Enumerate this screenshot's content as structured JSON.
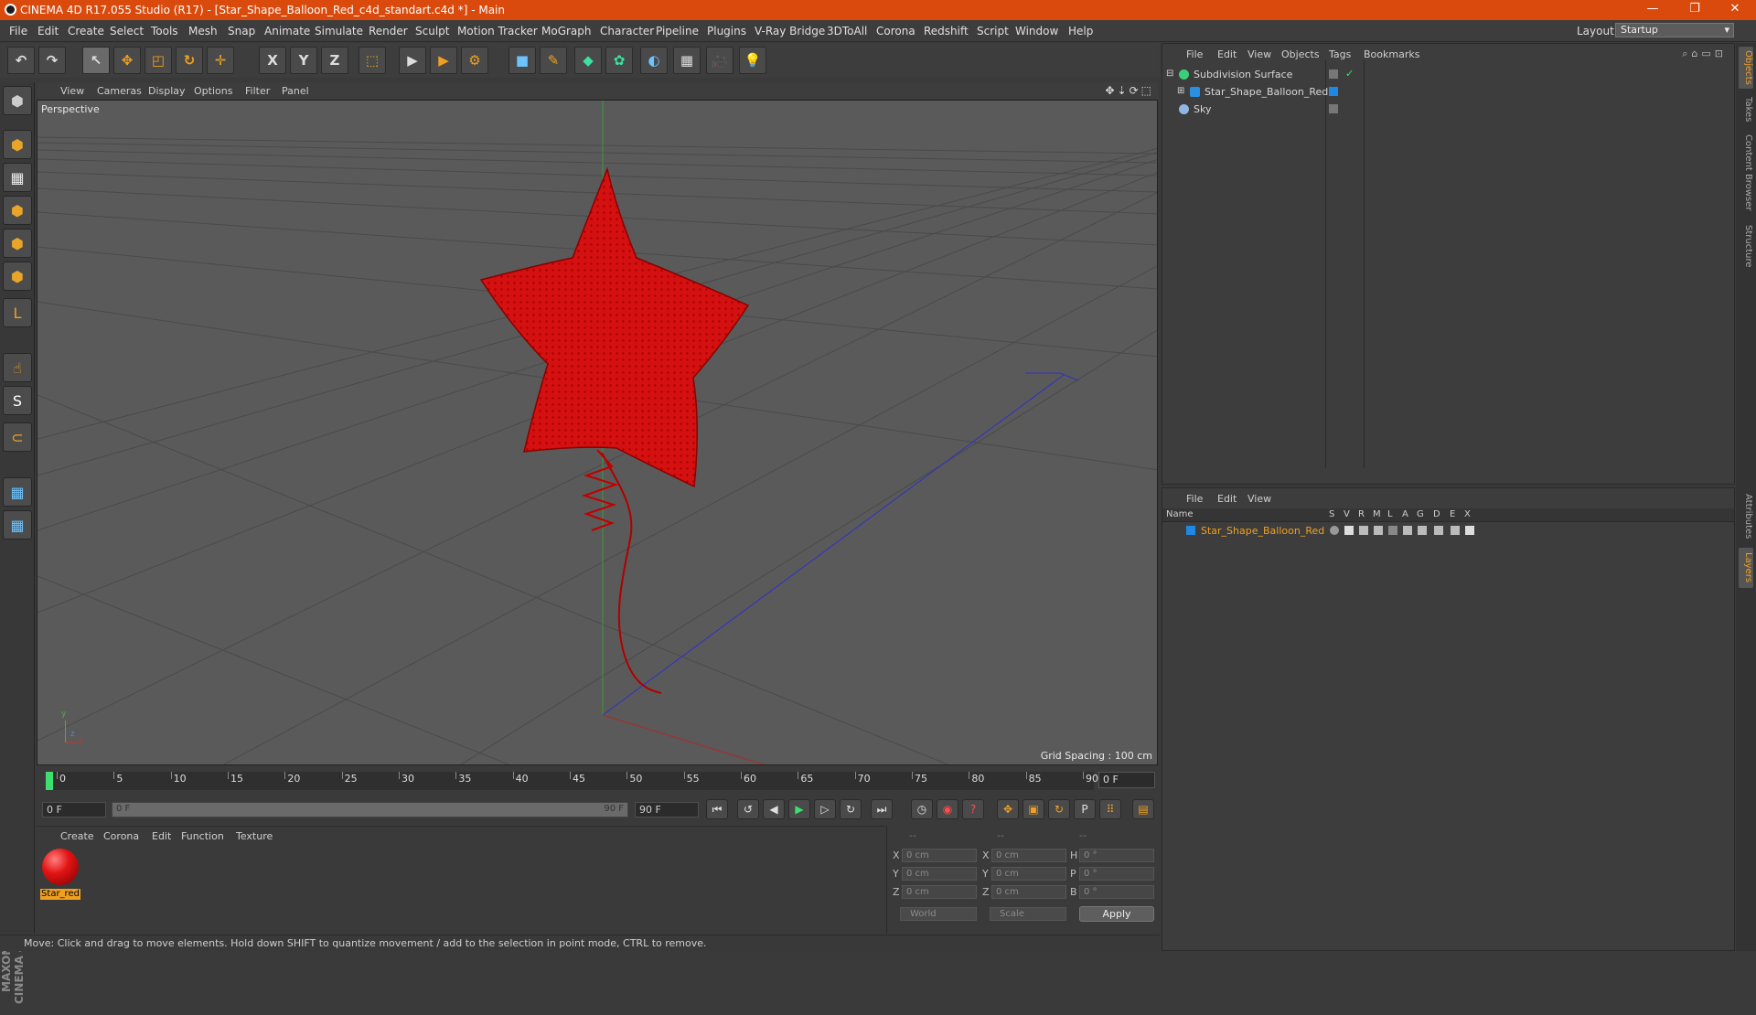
{
  "window": {
    "title": "CINEMA 4D R17.055 Studio (R17) - [Star_Shape_Balloon_Red_c4d_standart.c4d *] - Main",
    "minimize": "—",
    "restore": "❐",
    "close": "✕"
  },
  "menu": [
    "File",
    "Edit",
    "Create",
    "Select",
    "Tools",
    "Mesh",
    "Snap",
    "Animate",
    "Simulate",
    "Render",
    "Sculpt",
    "Motion Tracker",
    "MoGraph",
    "Character",
    "Pipeline",
    "Plugins",
    "V-Ray Bridge",
    "3DToAll",
    "Corona",
    "Redshift",
    "Script",
    "Window",
    "Help"
  ],
  "layout": {
    "label": "Layout:",
    "value": "Startup"
  },
  "toolbar": {
    "undo": "↶",
    "redo": "↷",
    "select": "↖",
    "move": "✥",
    "scale": "◰",
    "rotate": "↻",
    "move2": "✛",
    "x": "X",
    "y": "Y",
    "z": "Z",
    "coord": "⬚",
    "render_view": "▶",
    "render_pv": "▶",
    "render_settings": "⚙",
    "cube": "■",
    "pen": "✎",
    "subdiv": "◆",
    "array": "✿",
    "deform": "◐",
    "floor": "▦",
    "camera": "🎥",
    "light": "💡"
  },
  "left_tools": [
    "⬢",
    "⬢",
    "▦",
    "⬢",
    "⬢",
    "⬢",
    "L",
    "☝",
    "S",
    "⊂",
    "▦",
    "▦"
  ],
  "viewport": {
    "menu": [
      "View",
      "Cameras",
      "Display",
      "Options",
      "Filter",
      "Panel"
    ],
    "nav_icons": "✥⇣⟳⬚",
    "camera_label": "Perspective",
    "grid_spacing": "Grid Spacing : 100 cm",
    "axis": {
      "x": "x",
      "y": "y",
      "z": "z"
    }
  },
  "timeline": {
    "ticks": [
      0,
      5,
      10,
      15,
      20,
      25,
      30,
      35,
      40,
      45,
      50,
      55,
      60,
      65,
      70,
      75,
      80,
      85,
      90
    ],
    "current_frame": "0 F"
  },
  "transport": {
    "start": "0 F",
    "range_start": "0 F",
    "range_end": "90 F",
    "end": "90 F",
    "buttons": [
      "⏮",
      "↺",
      "◀",
      "▶",
      "▷",
      "↻",
      "⏭"
    ],
    "key_buttons": [
      "◷",
      "◉",
      "?",
      "✥",
      "▣",
      "↻",
      "P",
      "⠿",
      "▤"
    ]
  },
  "material_manager": {
    "menu": [
      "Create",
      "Corona",
      "Edit",
      "Function",
      "Texture"
    ],
    "material_name": "Star_red"
  },
  "coordinates": {
    "headers": [
      "--",
      "--",
      "--"
    ],
    "rows": [
      {
        "a": "X",
        "av": "0 cm",
        "b": "X",
        "bv": "0 cm",
        "c": "H",
        "cv": "0 °"
      },
      {
        "a": "Y",
        "av": "0 cm",
        "b": "Y",
        "bv": "0 cm",
        "c": "P",
        "cv": "0 °"
      },
      {
        "a": "Z",
        "av": "0 cm",
        "b": "Z",
        "bv": "0 cm",
        "c": "B",
        "cv": "0 °"
      }
    ],
    "mode": "World",
    "size_mode": "Scale",
    "apply": "Apply"
  },
  "status": "Move: Click and drag to move elements. Hold down SHIFT to quantize movement / add to the selection in point mode, CTRL to remove.",
  "object_manager": {
    "menu": [
      "File",
      "Edit",
      "View",
      "Objects",
      "Tags",
      "Bookmarks"
    ],
    "objects": [
      {
        "name": "Subdivision Surface",
        "color": "#3ad07a"
      },
      {
        "name": "Star_Shape_Balloon_Red",
        "color": "#2a8fe0"
      },
      {
        "name": "Sky",
        "color": "#8fb7e0"
      }
    ]
  },
  "layer_manager": {
    "menu": [
      "File",
      "Edit",
      "View"
    ],
    "columns": [
      "Name",
      "S",
      "V",
      "R",
      "M",
      "L",
      "A",
      "G",
      "D",
      "E",
      "X"
    ],
    "layer": {
      "name": "Star_Shape_Balloon_Red",
      "color": "#1e88e5"
    }
  },
  "right_tabs": [
    "Objects",
    "Takes",
    "Content Browser",
    "Structure",
    "Attributes",
    "Layers"
  ],
  "colors": {
    "accent": "#f0a020",
    "title": "#d94a0c",
    "balloon": "#e01010"
  }
}
